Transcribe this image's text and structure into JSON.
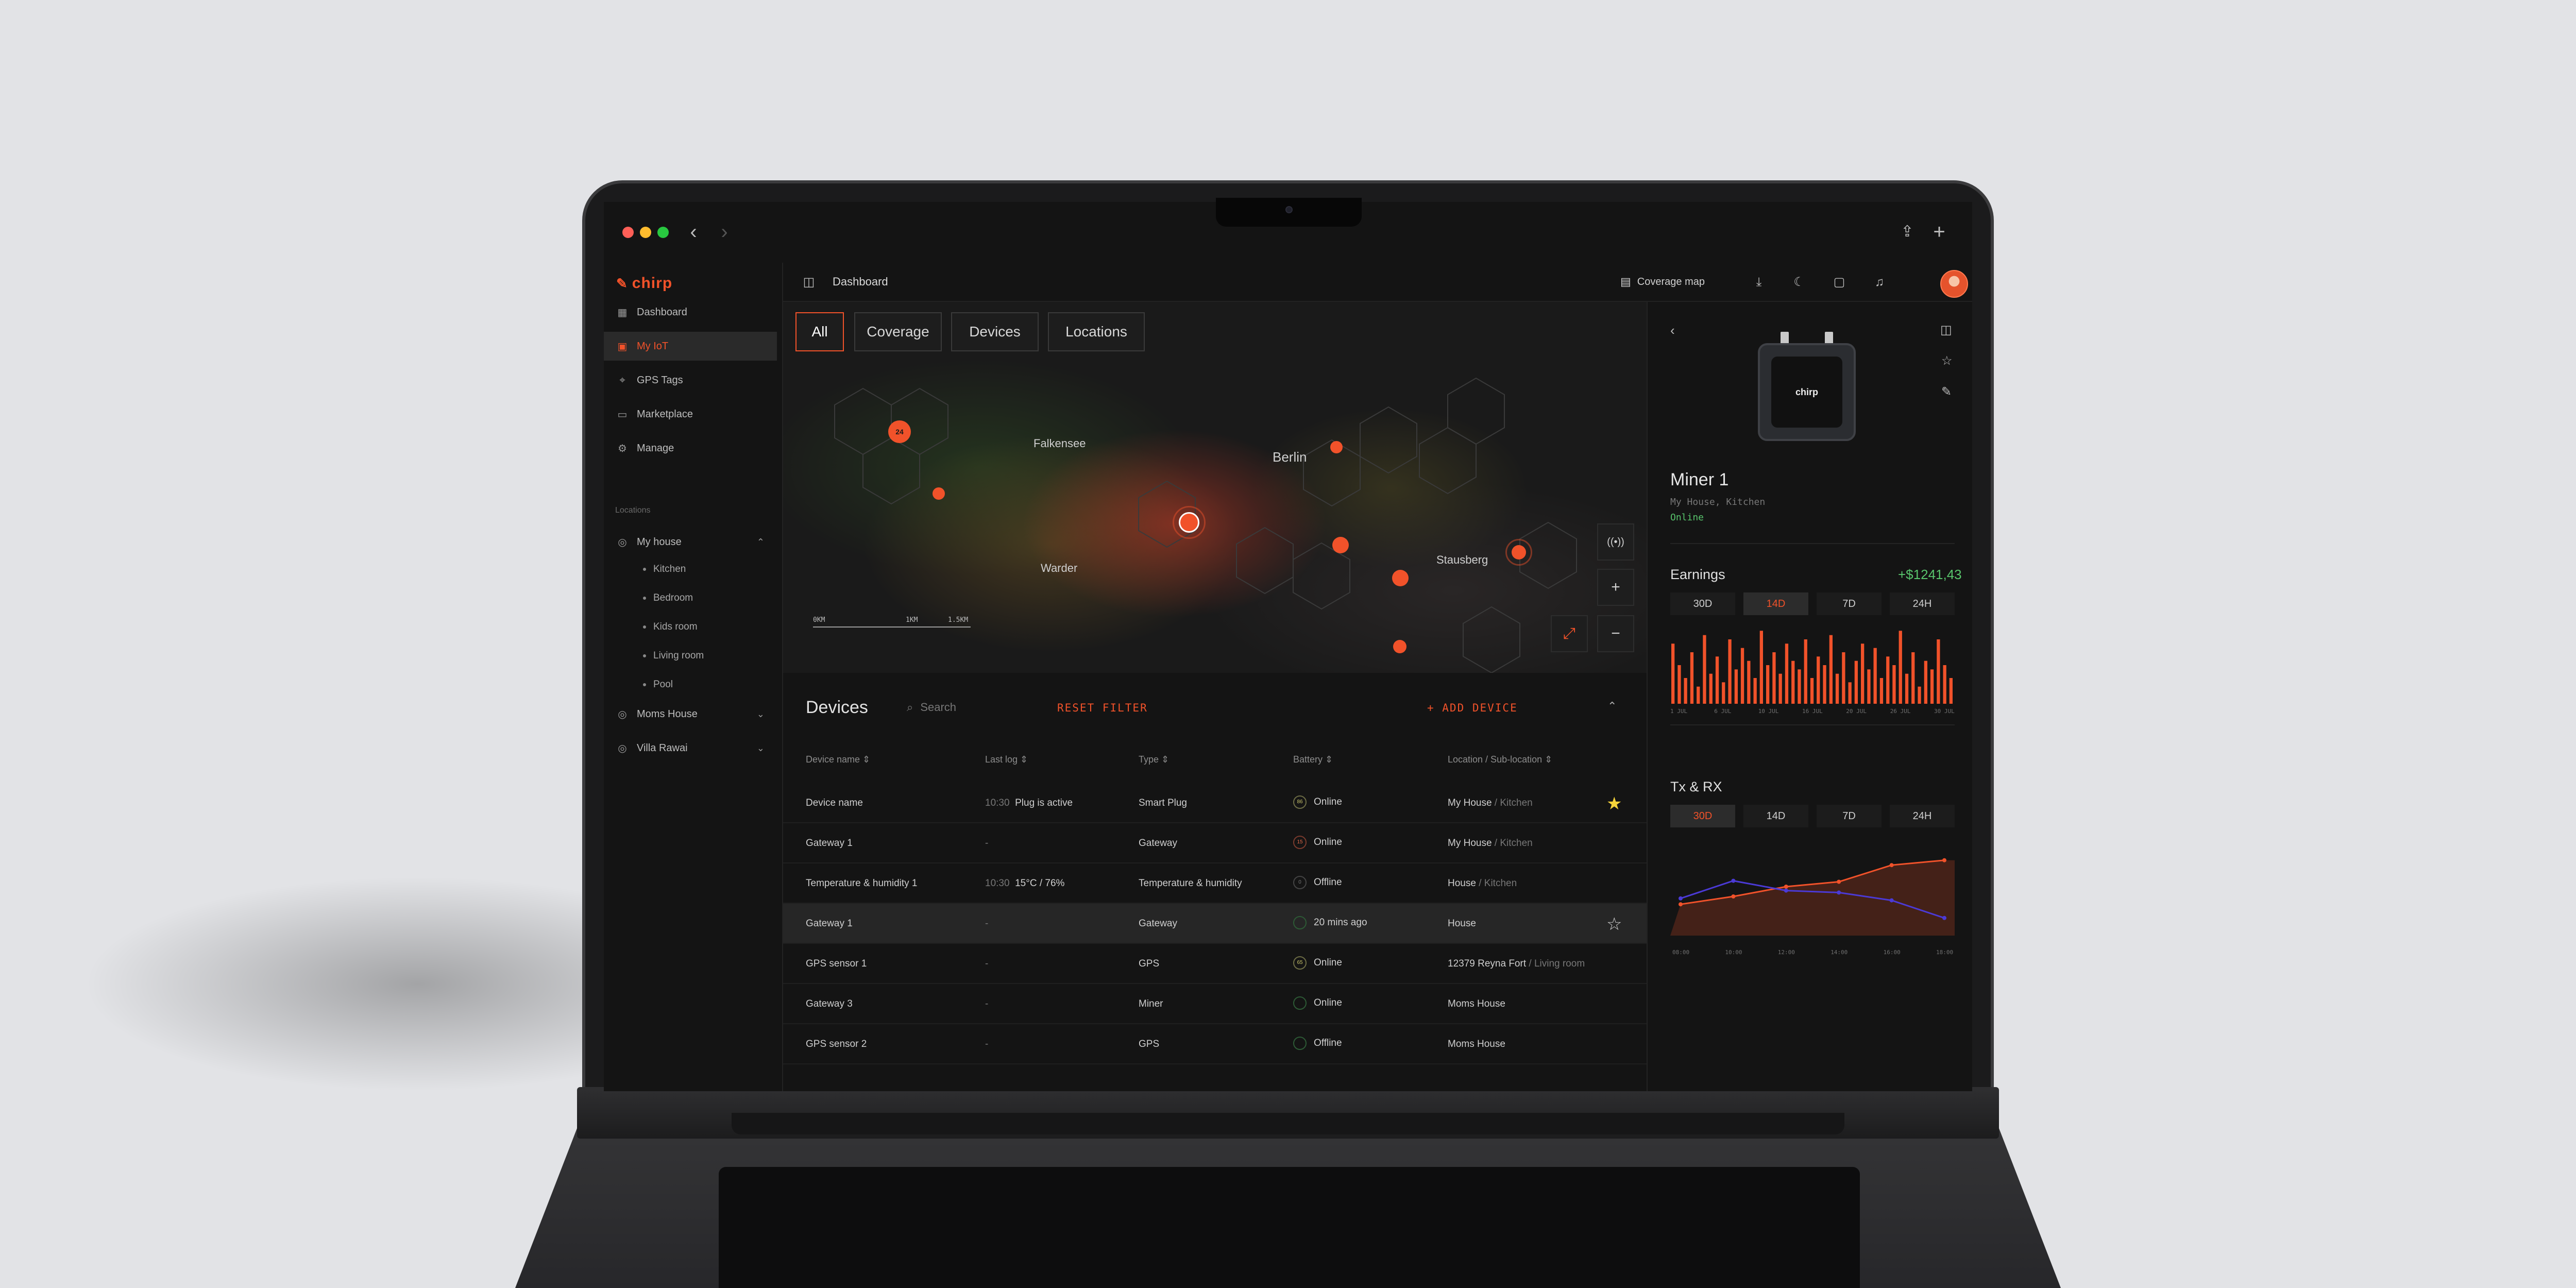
{
  "app": {
    "brand": "chirp"
  },
  "sidebar": {
    "items": [
      {
        "label": "Dashboard",
        "icon": "grid-icon"
      },
      {
        "label": "My IoT",
        "icon": "chip-icon",
        "active": true
      },
      {
        "label": "GPS Tags",
        "icon": "pin-icon"
      },
      {
        "label": "Marketplace",
        "icon": "store-icon"
      },
      {
        "label": "Manage",
        "icon": "gear-icon"
      }
    ],
    "locations_label": "Locations",
    "locations": [
      {
        "label": "My house",
        "expanded": true,
        "children": [
          "Kitchen",
          "Bedroom",
          "Kids room",
          "Living room",
          "Pool"
        ]
      },
      {
        "label": "Moms House",
        "expanded": false
      },
      {
        "label": "Villa Rawai",
        "expanded": false
      }
    ]
  },
  "header": {
    "title": "Dashboard",
    "coverage_link": "Coverage map"
  },
  "map": {
    "filters": [
      "All",
      "Coverage",
      "Devices",
      "Locations"
    ],
    "active_filter": "All",
    "cities": [
      "Falkensee",
      "Berlin",
      "Warder",
      "Stausberg"
    ],
    "cluster_count": "24",
    "scale_labels": [
      "0KM",
      "1KM",
      "1.5KM"
    ]
  },
  "devices": {
    "title": "Devices",
    "search_placeholder": "Search",
    "reset_label": "RESET FILTER",
    "add_label": "+ ADD DEVICE",
    "columns": [
      "Device name",
      "Last log",
      "Type",
      "Battery",
      "Location / Sub-location"
    ],
    "rows": [
      {
        "name": "Device name",
        "log_time": "10:30",
        "log_text": "Plug is active",
        "type": "Smart Plug",
        "batt": "86",
        "status": "Online",
        "location": "My House",
        "sub": "Kitchen",
        "star": "filled"
      },
      {
        "name": "Gateway 1",
        "log_time": "-",
        "log_text": "",
        "type": "Gateway",
        "batt": "15",
        "status": "Online",
        "location": "My House",
        "sub": "Kitchen",
        "star": ""
      },
      {
        "name": "Temperature & humidity 1",
        "log_time": "10:30",
        "log_text": "15°C / 76%",
        "type": "Temperature & humidity",
        "batt": "0",
        "status": "Offline",
        "location": "House",
        "sub": "Kitchen",
        "star": ""
      },
      {
        "name": "Gateway 1",
        "log_time": "-",
        "log_text": "",
        "type": "Gateway",
        "batt": "",
        "status": "20 mins ago",
        "location": "House",
        "sub": "",
        "star": "outline",
        "highlight": true
      },
      {
        "name": "GPS sensor 1",
        "log_time": "-",
        "log_text": "",
        "type": "GPS",
        "batt": "65",
        "status": "Online",
        "location": "12379 Reyna Fort",
        "sub": "Living room",
        "star": ""
      },
      {
        "name": "Gateway 3",
        "log_time": "-",
        "log_text": "",
        "type": "Miner",
        "batt": "",
        "status": "Online",
        "location": "Moms House",
        "sub": "",
        "star": ""
      },
      {
        "name": "GPS sensor 2",
        "log_time": "-",
        "log_text": "",
        "type": "GPS",
        "batt": "",
        "status": "Offline",
        "location": "Moms House",
        "sub": "",
        "star": ""
      }
    ]
  },
  "panel": {
    "device_name": "Miner 1",
    "device_brand": "chirp",
    "location": "My House, Kitchen",
    "status": "Online",
    "earnings_title": "Earnings",
    "earnings_value": "+$1241,43",
    "earnings_tabs": [
      "30D",
      "14D",
      "7D",
      "24H"
    ],
    "earnings_active": "14D",
    "txrx_title": "Tx & RX",
    "txrx_tabs": [
      "30D",
      "14D",
      "7D",
      "24H"
    ],
    "txrx_active": "30D"
  },
  "colors": {
    "accent": "#f1522a",
    "online": "#58c46c",
    "star": "#f5d33a",
    "rx": "#4b3ad6"
  },
  "chart_data": [
    {
      "type": "bar",
      "name": "earnings",
      "categories": [
        "1",
        "2",
        "3",
        "4",
        "5",
        "6",
        "7",
        "8",
        "9",
        "10",
        "11",
        "12",
        "13",
        "14",
        "15",
        "16",
        "17",
        "18",
        "19",
        "20",
        "21",
        "22",
        "23",
        "24",
        "25",
        "26",
        "27",
        "28",
        "29",
        "30",
        "31",
        "32",
        "33",
        "34",
        "35",
        "36",
        "37",
        "38",
        "39",
        "40",
        "41",
        "42",
        "43",
        "44",
        "45"
      ],
      "values": [
        70,
        45,
        30,
        60,
        20,
        80,
        35,
        55,
        25,
        75,
        40,
        65,
        50,
        30,
        85,
        45,
        60,
        35,
        70,
        50,
        40,
        75,
        30,
        55,
        45,
        80,
        35,
        60,
        25,
        50,
        70,
        40,
        65,
        30,
        55,
        45,
        85,
        35,
        60,
        20,
        50,
        40,
        75,
        45,
        30
      ],
      "tick_labels": [
        "1 JUL",
        "6 JUL",
        "10 JUL",
        "16 JUL",
        "20 JUL",
        "26 JUL",
        "30 JUL"
      ]
    },
    {
      "type": "line",
      "name": "tx_rx",
      "x": [
        "08:00",
        "10:00",
        "12:00",
        "14:00",
        "16:00",
        "18:00"
      ],
      "series": [
        {
          "values": [
            32,
            40,
            50,
            55,
            72,
            77
          ]
        },
        {
          "values": [
            38,
            56,
            46,
            44,
            36,
            18
          ]
        }
      ]
    }
  ]
}
